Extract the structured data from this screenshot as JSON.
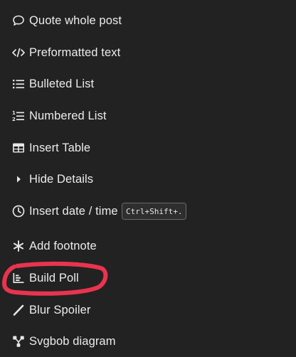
{
  "menu": {
    "items": [
      {
        "label": "Quote whole post",
        "icon": "speech-bubble-icon"
      },
      {
        "label": "Preformatted text",
        "icon": "code-icon"
      },
      {
        "label": "Bulleted List",
        "icon": "bulleted-list-icon"
      },
      {
        "label": "Numbered List",
        "icon": "numbered-list-icon"
      },
      {
        "label": "Insert Table",
        "icon": "table-icon"
      },
      {
        "label": "Hide Details",
        "icon": "caret-right-icon"
      },
      {
        "label": "Insert date / time",
        "icon": "clock-icon",
        "shortcut": "Ctrl+Shift+."
      },
      {
        "label": "Add footnote",
        "icon": "asterisk-icon"
      },
      {
        "label": "Build Poll",
        "icon": "chart-icon"
      },
      {
        "label": "Blur Spoiler",
        "icon": "wand-icon"
      },
      {
        "label": "Svgbob diagram",
        "icon": "diagram-icon"
      }
    ]
  },
  "annotation": {
    "color": "#e8344e",
    "target": "Build Poll"
  },
  "theme": {
    "background": "#222222",
    "text": "#ececec"
  }
}
